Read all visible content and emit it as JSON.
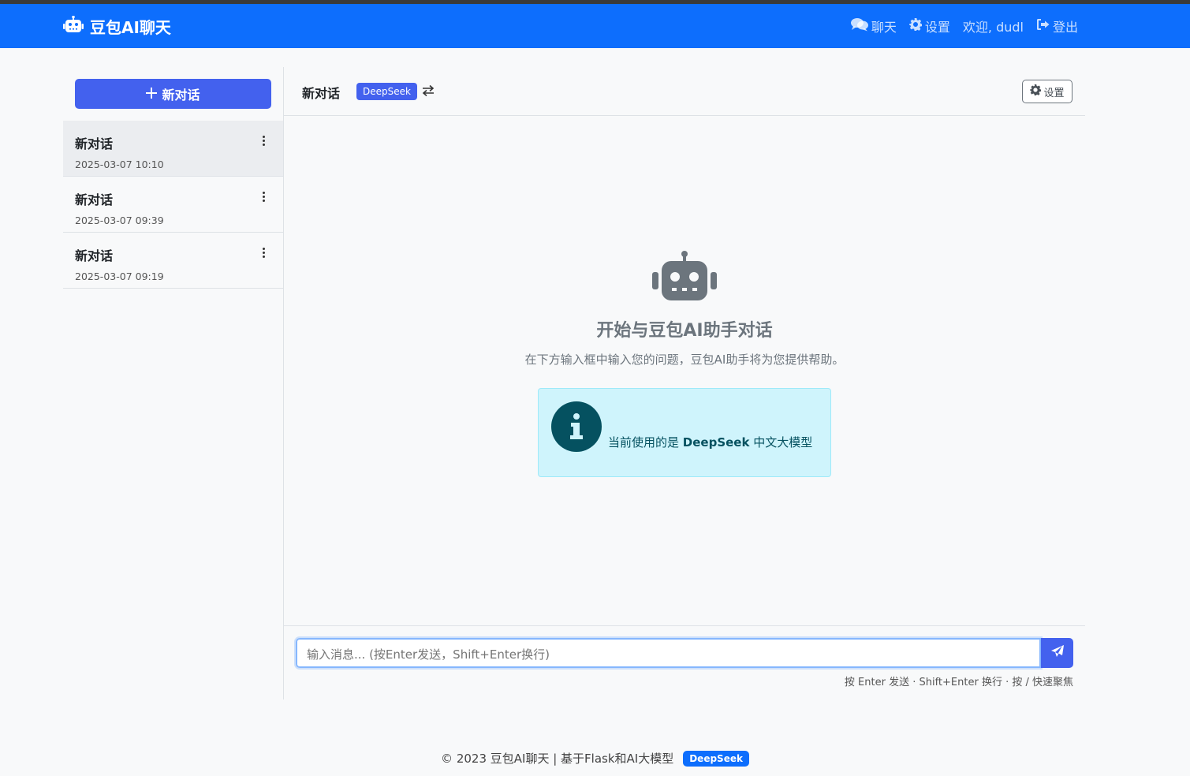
{
  "app": {
    "brand": "豆包AI聊天",
    "nav": {
      "chat": "聊天",
      "settings": "设置",
      "welcome": "欢迎, dudl",
      "logout": "登出"
    }
  },
  "sidebar": {
    "new_chat_label": "新对话",
    "conversations": [
      {
        "title": "新对话",
        "time": "2025-03-07 10:10",
        "active": true
      },
      {
        "title": "新对话",
        "time": "2025-03-07 09:39",
        "active": false
      },
      {
        "title": "新对话",
        "time": "2025-03-07 09:19",
        "active": false
      }
    ]
  },
  "chat": {
    "title": "新对话",
    "model_badge": "DeepSeek",
    "settings_label": "设置",
    "welcome_title": "开始与豆包AI助手对话",
    "welcome_subtitle": "在下方输入框中输入您的问题，豆包AI助手将为您提供帮助。",
    "info_prefix": "当前使用的是",
    "info_model": "DeepSeek",
    "info_suffix": "中文大模型",
    "input_placeholder": "输入消息... (按Enter发送，Shift+Enter换行)",
    "input_hint": "按 Enter 发送 · Shift+Enter 换行 · 按 / 快速聚焦"
  },
  "footer": {
    "text": "© 2023 豆包AI聊天 | 基于Flask和AI大模型",
    "badge": "DeepSeek"
  },
  "colors": {
    "navbar": "#0d6efd",
    "accent": "#4361ee",
    "info_bg": "#cff4fc",
    "info_text": "#055160"
  }
}
